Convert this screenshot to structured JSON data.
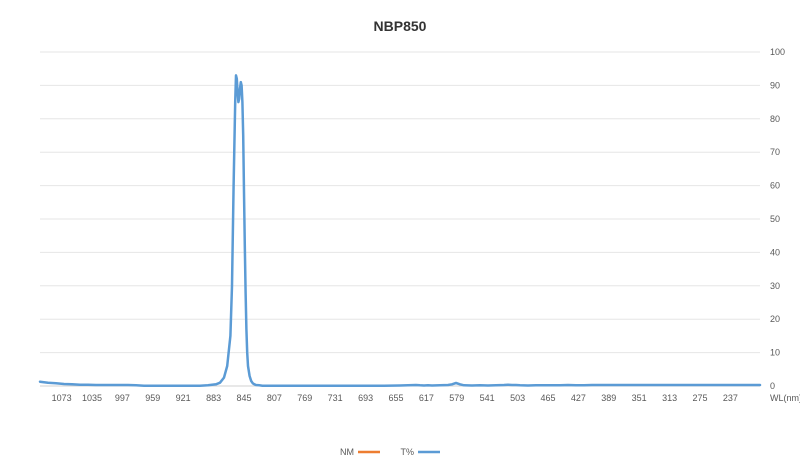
{
  "chart_data": {
    "type": "line",
    "title": "NBP850",
    "xlabel": "WL(nm)",
    "ylabel": "",
    "x_direction": "reversed",
    "y_axis_side": "right",
    "grid": true,
    "legend_position": "bottom",
    "xlim": [
      1100,
      200
    ],
    "ylim": [
      0,
      100
    ],
    "y_ticks": [
      0,
      10,
      20,
      30,
      40,
      50,
      60,
      70,
      80,
      90,
      100
    ],
    "x_tick_labels": [
      "1073",
      "1035",
      "997",
      "959",
      "921",
      "883",
      "845",
      "807",
      "769",
      "731",
      "693",
      "655",
      "617",
      "579",
      "541",
      "503",
      "465",
      "427",
      "389",
      "351",
      "313",
      "275",
      "237"
    ],
    "x_ticks": [
      1073,
      1035,
      997,
      959,
      921,
      883,
      845,
      807,
      769,
      731,
      693,
      655,
      617,
      579,
      541,
      503,
      465,
      427,
      389,
      351,
      313,
      275,
      237
    ],
    "series": [
      {
        "name": "T%",
        "color": "#5b9bd5",
        "x": [
          1100,
          1090,
          1080,
          1070,
          1060,
          1050,
          1040,
          1030,
          1020,
          1010,
          1000,
          990,
          980,
          970,
          960,
          950,
          940,
          930,
          920,
          910,
          900,
          890,
          880,
          875,
          870,
          866,
          862,
          860,
          858,
          856,
          855,
          854,
          853,
          852,
          851,
          850,
          849,
          848,
          847,
          846,
          845,
          844,
          843,
          842,
          841,
          840,
          838,
          836,
          834,
          832,
          830,
          826,
          822,
          815,
          805,
          790,
          770,
          750,
          730,
          710,
          690,
          670,
          650,
          640,
          630,
          625,
          620,
          615,
          610,
          600,
          590,
          585,
          580,
          575,
          570,
          560,
          550,
          540,
          530,
          520,
          515,
          510,
          505,
          500,
          490,
          480,
          470,
          460,
          450,
          440,
          430,
          420,
          410,
          400,
          390,
          380,
          370,
          360,
          350,
          340,
          330,
          320,
          310,
          300,
          290,
          280,
          270,
          260,
          250,
          240,
          230,
          220,
          210,
          200
        ],
        "values": [
          1.3,
          1.0,
          0.8,
          0.6,
          0.5,
          0.4,
          0.35,
          0.3,
          0.3,
          0.3,
          0.3,
          0.3,
          0.2,
          0.1,
          0.1,
          0.1,
          0.1,
          0.1,
          0.1,
          0.1,
          0.1,
          0.2,
          0.5,
          1.0,
          2.5,
          6,
          15,
          30,
          60,
          85,
          93,
          92,
          88,
          85,
          86,
          89,
          91,
          90,
          85,
          75,
          58,
          42,
          28,
          17,
          10,
          6,
          3,
          1.5,
          0.8,
          0.5,
          0.3,
          0.2,
          0.1,
          0.1,
          0.1,
          0.1,
          0.1,
          0.1,
          0.1,
          0.1,
          0.1,
          0.1,
          0.15,
          0.2,
          0.3,
          0.2,
          0.15,
          0.2,
          0.15,
          0.2,
          0.3,
          0.5,
          0.9,
          0.5,
          0.2,
          0.15,
          0.2,
          0.15,
          0.2,
          0.3,
          0.4,
          0.3,
          0.3,
          0.2,
          0.15,
          0.2,
          0.2,
          0.2,
          0.2,
          0.3,
          0.2,
          0.2,
          0.3,
          0.3,
          0.3,
          0.3,
          0.3,
          0.3,
          0.3,
          0.3,
          0.3,
          0.3,
          0.3,
          0.3,
          0.3,
          0.3,
          0.3,
          0.3,
          0.3,
          0.3,
          0.3,
          0.3,
          0.3,
          0.3
        ]
      },
      {
        "name": "NM",
        "color": "#ed7d31",
        "x": [],
        "values": []
      }
    ]
  }
}
